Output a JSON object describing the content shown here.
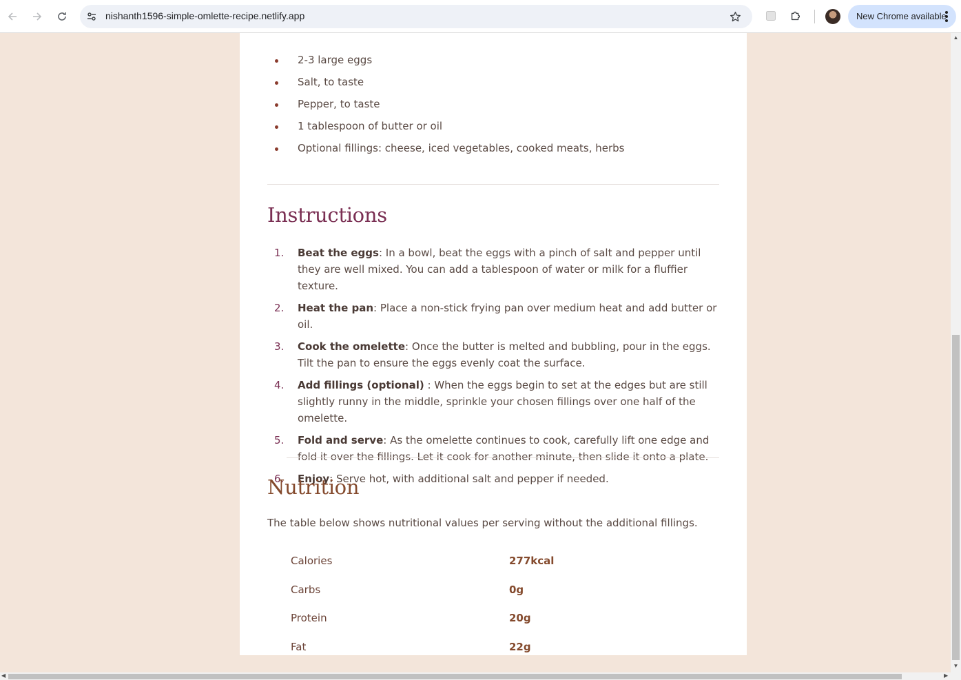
{
  "browser": {
    "url": "nishanth1596-simple-omlette-recipe.netlify.app",
    "update_label": "New Chrome available",
    "icons": {
      "back": "back-arrow-icon",
      "forward": "forward-arrow-icon",
      "reload": "reload-icon",
      "site_info": "tune-icon",
      "bookmark": "star-icon",
      "extension": "puzzle-icon",
      "profile": "avatar"
    }
  },
  "ingredients": {
    "items": [
      "2-3 large eggs",
      "Salt, to taste",
      "Pepper, to taste",
      "1 tablespoon of butter or oil",
      "Optional fillings: cheese, iced vegetables, cooked meats, herbs"
    ]
  },
  "instructions": {
    "title": "Instructions",
    "steps": [
      {
        "num": "1.",
        "title": "Beat the eggs",
        "text": ": In a bowl, beat the eggs with a pinch of salt and pepper until they are well mixed. You can add a tablespoon of water or milk for a fluffier texture."
      },
      {
        "num": "2.",
        "title": "Heat the pan",
        "text": ": Place a non-stick frying pan over medium heat and add butter or oil."
      },
      {
        "num": "3.",
        "title": "Cook the omelette",
        "text": ": Once the butter is melted and bubbling, pour in the eggs. Tilt the pan to ensure the eggs evenly coat the surface."
      },
      {
        "num": "4.",
        "title": "Add fillings (optional)",
        "text": " : When the eggs begin to set at the edges but are still slightly runny in the middle, sprinkle your chosen fillings over one half of the omelette."
      },
      {
        "num": "5.",
        "title": "Fold and serve",
        "text": ": As the omelette continues to cook, carefully lift one edge and fold it over the fillings. Let it cook for another minute, then slide it onto a plate."
      },
      {
        "num": "6.",
        "title": "Enjoy",
        "text": ": Serve hot, with additional salt and pepper if needed."
      }
    ]
  },
  "nutrition": {
    "title": "Nutrition",
    "intro": "The table below shows nutritional values per serving without the additional fillings.",
    "rows": [
      {
        "label": "Calories",
        "value": "277kcal"
      },
      {
        "label": "Carbs",
        "value": "0g"
      },
      {
        "label": "Protein",
        "value": "20g"
      },
      {
        "label": "Fat",
        "value": "22g"
      }
    ]
  },
  "colors": {
    "page_bg": "#f3e5da",
    "card_bg": "#ffffff",
    "instructions_heading": "#7a2f53",
    "nutrition_heading": "#844a2d",
    "body_text": "#5a4a44",
    "update_pill": "#d3e3fd"
  }
}
